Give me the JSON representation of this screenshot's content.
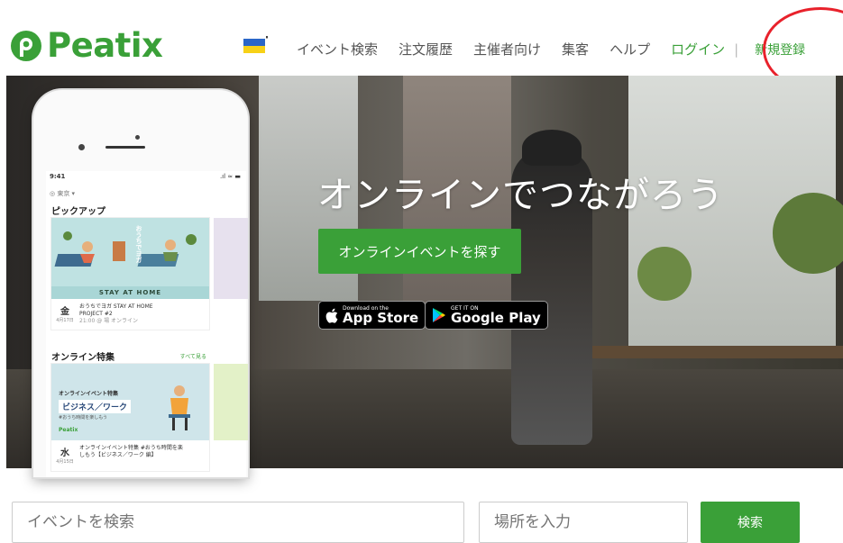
{
  "brand": {
    "name": "Peatix",
    "color": "#3aa038"
  },
  "header": {
    "flag_icon": "ukraine-flag-heart-icon",
    "nav": [
      "イベント検索",
      "注文履歴",
      "主催者向け",
      "集客",
      "ヘルプ"
    ],
    "login_label": "ログイン",
    "separator": "|",
    "signup_label": "新規登録"
  },
  "hero": {
    "title": "オンラインでつながろう",
    "cta_label": "オンラインイベントを探す",
    "app_store": {
      "small": "Download on the",
      "big": "App Store"
    },
    "google_play": {
      "small": "GET IT ON",
      "big": "Google Play"
    }
  },
  "phone": {
    "status_time": "9:41",
    "status_icons": ".ıl ≈ ▬",
    "location": "◎ 東京 ▾",
    "pickup_title": "ピックアップ",
    "card1": {
      "banner": "STAY AT HOME",
      "vertical_text": "おうちでヨガ",
      "day": "金",
      "date": "4月17日",
      "line1": "おうちでヨガ STAY AT HOME",
      "line2": "PROJECT #2",
      "line3": "21:00 @ 場 オンライン"
    },
    "online_title": "オンライン特集",
    "see_all": "すべて見る",
    "card2": {
      "tag": "オンラインイベント特集",
      "label": "ビジネス／ワーク",
      "hashtag": "#おうち時間を楽しもう",
      "logo": "Peatix",
      "day": "水",
      "date": "4月15日",
      "line1": "オンラインイベント特集 #おうち時間を楽",
      "line2": "しもう【ビジネス／ワーク 編】"
    }
  },
  "search": {
    "event_placeholder": "イベントを検索",
    "place_placeholder": "場所を入力",
    "button_label": "検索"
  }
}
